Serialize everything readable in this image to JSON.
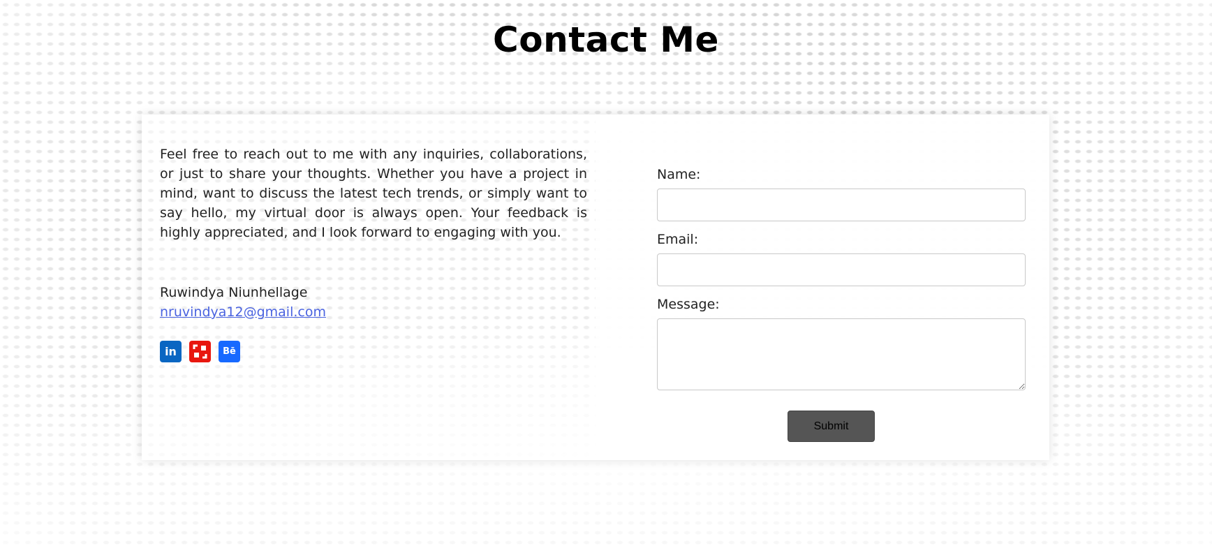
{
  "page": {
    "title": "Contact Me"
  },
  "intro": {
    "text": "Feel free to reach out to me with any inquiries, collaborations, or just to share your thoughts. Whether you have a project in mind, want to discuss the latest tech trends, or simply want to say hello, my virtual door is always open. Your feedback is highly appreciated, and I look forward to engaging with you."
  },
  "author": {
    "name": "Ruwindya Niunhellage",
    "email": "nruvindya12@gmail.com"
  },
  "socials": [
    {
      "icon": "linkedin-icon",
      "glyph": "in",
      "color": "#0a66c2"
    },
    {
      "icon": "speakerdeck-icon",
      "glyph": "",
      "color": "#e8170f"
    },
    {
      "icon": "behance-icon",
      "glyph": "Bē",
      "color": "#1769ff"
    }
  ],
  "form": {
    "name_label": "Name:",
    "name_value": "",
    "email_label": "Email:",
    "email_value": "",
    "message_label": "Message:",
    "message_value": "",
    "submit_label": "Submit"
  },
  "colors": {
    "link": "#4a63e0",
    "button": "#555555"
  }
}
